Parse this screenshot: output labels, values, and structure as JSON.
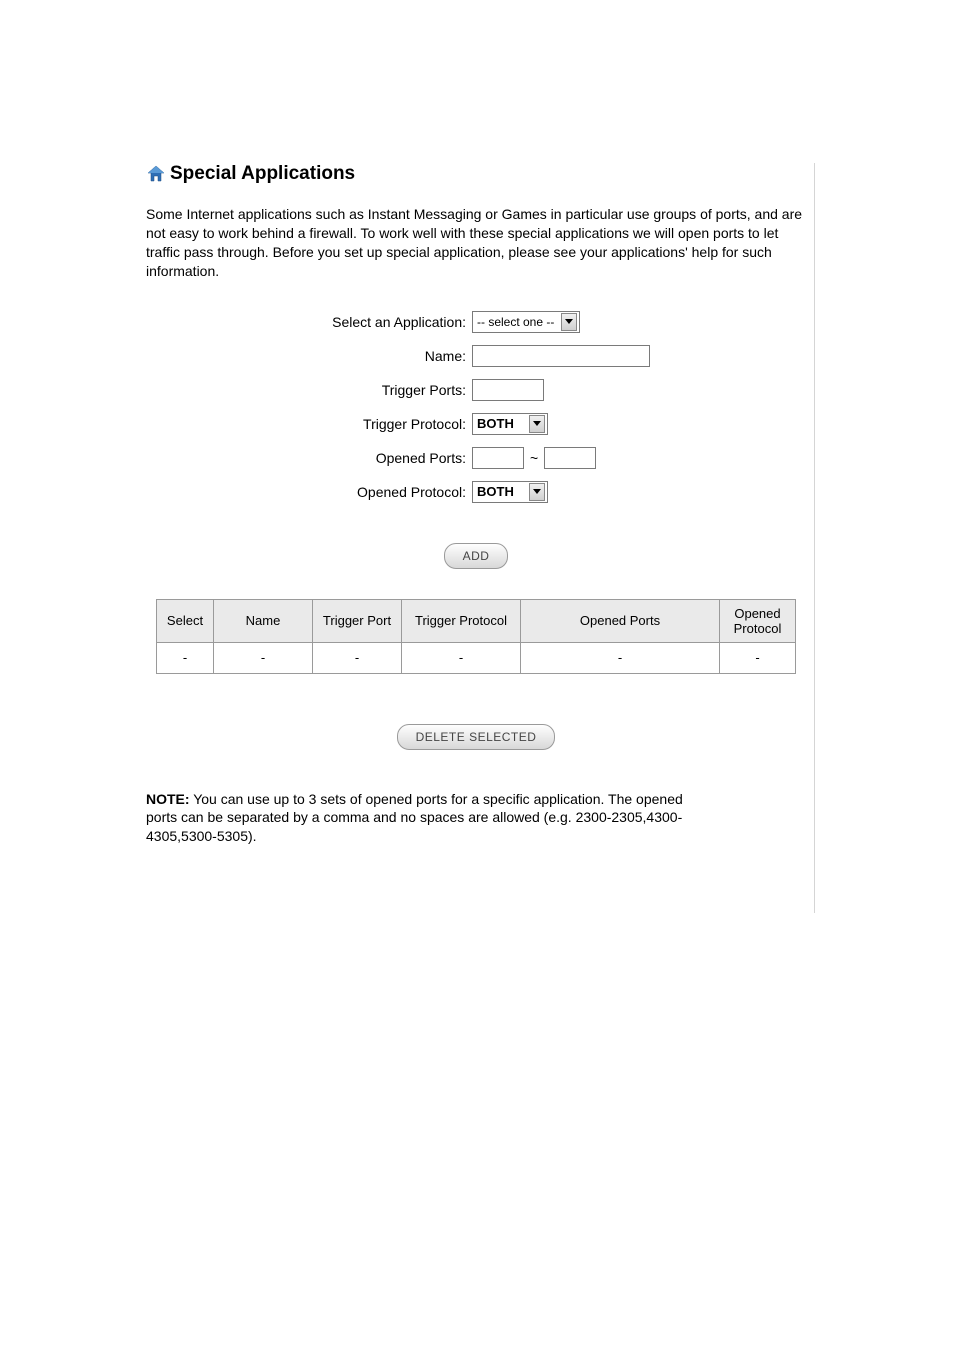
{
  "header": {
    "title": "Special Applications",
    "intro": "Some Internet applications such as Instant Messaging or Games in particular use groups of ports, and are not easy to work behind a firewall. To work well with these special applications we will open ports to let traffic pass through. Before you set up special application, please see your applications' help for such information."
  },
  "form": {
    "select_app_label": "Select an Application:",
    "select_app_value": "-- select one --",
    "name_label": "Name:",
    "name_value": "",
    "trigger_ports_label": "Trigger Ports:",
    "trigger_ports_value": "",
    "trigger_protocol_label": "Trigger Protocol:",
    "trigger_protocol_value": "BOTH",
    "opened_ports_label": "Opened Ports:",
    "opened_ports_from": "",
    "opened_ports_sep": "~",
    "opened_ports_to": "",
    "opened_protocol_label": "Opened Protocol:",
    "opened_protocol_value": "BOTH"
  },
  "buttons": {
    "add": "ADD",
    "delete_selected": "DELETE SELECTED"
  },
  "table": {
    "headers": {
      "select": "Select",
      "name": "Name",
      "trigger_port": "Trigger Port",
      "trigger_protocol": "Trigger Protocol",
      "opened_ports": "Opened Ports",
      "opened_protocol": "Opened Protocol"
    },
    "rows": [
      {
        "select": "-",
        "name": "-",
        "trigger_port": "-",
        "trigger_protocol": "-",
        "opened_ports": "-",
        "opened_protocol": "-"
      }
    ]
  },
  "note": {
    "label": "NOTE:",
    "text": " You can use up to 3 sets of opened ports for a specific application. The opened ports can be separated by a comma and no spaces are allowed (e.g. 2300-2305,4300-4305,5300-5305)."
  }
}
